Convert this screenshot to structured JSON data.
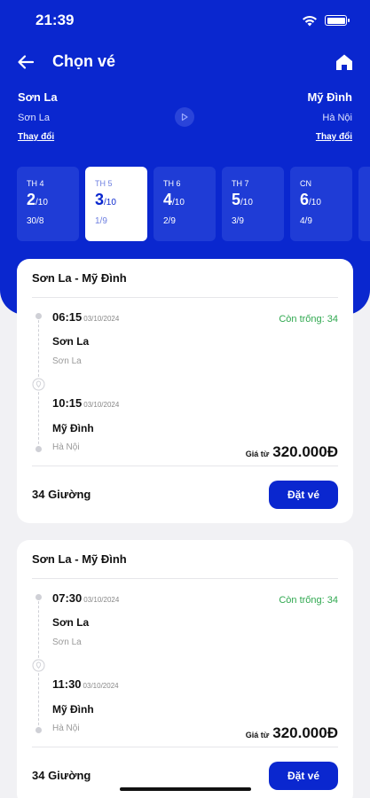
{
  "status_bar": {
    "time": "21:39"
  },
  "nav": {
    "title": "Chọn vé"
  },
  "route": {
    "from": {
      "city": "Sơn La",
      "sub": "Sơn La",
      "change_label": "Thay đổi"
    },
    "to": {
      "city": "Mỹ Đình",
      "sub": "Hà Nội",
      "change_label": "Thay đổi"
    }
  },
  "dates": [
    {
      "dow": "TH 4",
      "day": "2",
      "month": "/10",
      "date": "30/8",
      "selected": false
    },
    {
      "dow": "TH 5",
      "day": "3",
      "month": "/10",
      "date": "1/9",
      "selected": true
    },
    {
      "dow": "TH 6",
      "day": "4",
      "month": "/10",
      "date": "2/9",
      "selected": false
    },
    {
      "dow": "TH 7",
      "day": "5",
      "month": "/10",
      "date": "3/9",
      "selected": false
    },
    {
      "dow": "CN",
      "day": "6",
      "month": "/10",
      "date": "4/9",
      "selected": false
    },
    {
      "dow": "",
      "day": "",
      "month": "",
      "date": "",
      "selected": false
    }
  ],
  "trips": [
    {
      "route": "Sơn La - Mỹ Đình",
      "dep_time": "06:15",
      "dep_date": "03/10/2024",
      "dep_name": "Sơn La",
      "dep_sub": "Sơn La",
      "arr_time": "10:15",
      "arr_date": "03/10/2024",
      "arr_name": "Mỹ Đình",
      "arr_sub": "Hà Nội",
      "seats": "Còn trống: 34",
      "price_label": "Giá từ",
      "price": "320.000Đ",
      "beds": "34 Giường",
      "book_label": "Đặt vé"
    },
    {
      "route": "Sơn La - Mỹ Đình",
      "dep_time": "07:30",
      "dep_date": "03/10/2024",
      "dep_name": "Sơn La",
      "dep_sub": "Sơn La",
      "arr_time": "11:30",
      "arr_date": "03/10/2024",
      "arr_name": "Mỹ Đình",
      "arr_sub": "Hà Nội",
      "seats": "Còn trống: 34",
      "price_label": "Giá từ",
      "price": "320.000Đ",
      "beds": "34 Giường",
      "book_label": "Đặt vé"
    }
  ],
  "colors": {
    "primary": "#0a27cf",
    "seats_green": "#2fa84f",
    "background": "#f1f1f4"
  },
  "icons": {
    "back": "arrow-left-icon",
    "home": "home-icon",
    "swap": "play-circle-icon",
    "timeline": "location-pin-icon"
  }
}
